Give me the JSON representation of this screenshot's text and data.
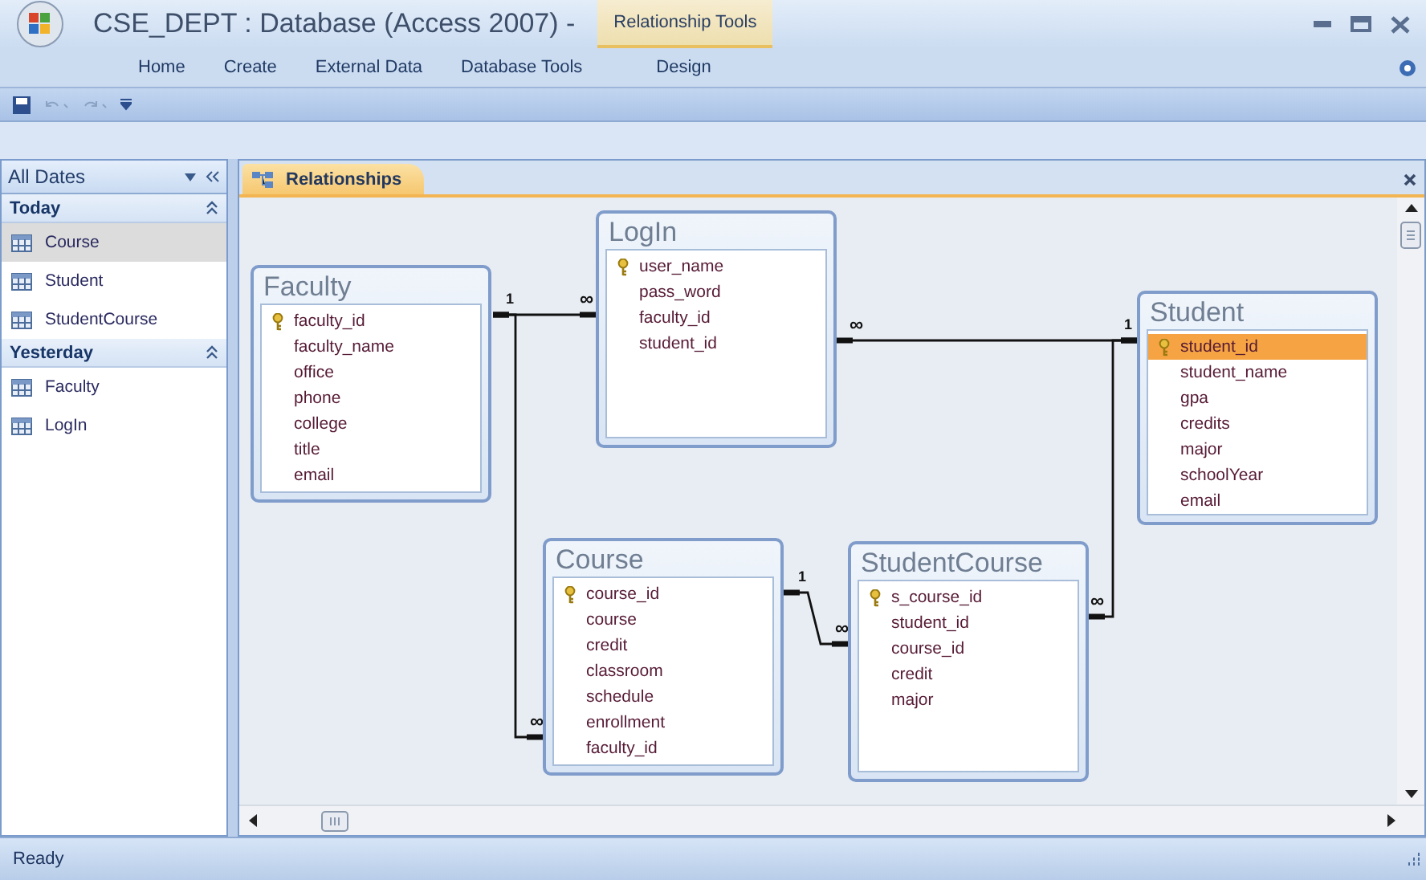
{
  "window": {
    "title": "CSE_DEPT : Database (Access 2007) -",
    "contextual_tab": "Relationship Tools"
  },
  "ribbon_tabs": [
    "Home",
    "Create",
    "External Data",
    "Database Tools",
    "Design"
  ],
  "navigation": {
    "header": "All Dates",
    "groups": [
      {
        "label": "Today",
        "expanded": true,
        "items": [
          {
            "label": "Course",
            "selected": true
          },
          {
            "label": "Student",
            "selected": false
          },
          {
            "label": "StudentCourse",
            "selected": false
          }
        ]
      },
      {
        "label": "Yesterday",
        "expanded": true,
        "items": [
          {
            "label": "Faculty",
            "selected": false
          },
          {
            "label": "LogIn",
            "selected": false
          }
        ]
      }
    ]
  },
  "document_tab": {
    "label": "Relationships"
  },
  "tables": [
    {
      "name": "Faculty",
      "fields": [
        {
          "name": "faculty_id",
          "primary_key": true,
          "selected": false
        },
        {
          "name": "faculty_name",
          "primary_key": false,
          "selected": false
        },
        {
          "name": "office",
          "primary_key": false,
          "selected": false
        },
        {
          "name": "phone",
          "primary_key": false,
          "selected": false
        },
        {
          "name": "college",
          "primary_key": false,
          "selected": false
        },
        {
          "name": "title",
          "primary_key": false,
          "selected": false
        },
        {
          "name": "email",
          "primary_key": false,
          "selected": false
        }
      ]
    },
    {
      "name": "LogIn",
      "fields": [
        {
          "name": "user_name",
          "primary_key": true,
          "selected": false
        },
        {
          "name": "pass_word",
          "primary_key": false,
          "selected": false
        },
        {
          "name": "faculty_id",
          "primary_key": false,
          "selected": false
        },
        {
          "name": "student_id",
          "primary_key": false,
          "selected": false
        }
      ]
    },
    {
      "name": "Student",
      "fields": [
        {
          "name": "student_id",
          "primary_key": true,
          "selected": true
        },
        {
          "name": "student_name",
          "primary_key": false,
          "selected": false
        },
        {
          "name": "gpa",
          "primary_key": false,
          "selected": false
        },
        {
          "name": "credits",
          "primary_key": false,
          "selected": false
        },
        {
          "name": "major",
          "primary_key": false,
          "selected": false
        },
        {
          "name": "schoolYear",
          "primary_key": false,
          "selected": false
        },
        {
          "name": "email",
          "primary_key": false,
          "selected": false
        }
      ]
    },
    {
      "name": "Course",
      "fields": [
        {
          "name": "course_id",
          "primary_key": true,
          "selected": false
        },
        {
          "name": "course",
          "primary_key": false,
          "selected": false
        },
        {
          "name": "credit",
          "primary_key": false,
          "selected": false
        },
        {
          "name": "classroom",
          "primary_key": false,
          "selected": false
        },
        {
          "name": "schedule",
          "primary_key": false,
          "selected": false
        },
        {
          "name": "enrollment",
          "primary_key": false,
          "selected": false
        },
        {
          "name": "faculty_id",
          "primary_key": false,
          "selected": false
        }
      ]
    },
    {
      "name": "StudentCourse",
      "fields": [
        {
          "name": "s_course_id",
          "primary_key": true,
          "selected": false
        },
        {
          "name": "student_id",
          "primary_key": false,
          "selected": false
        },
        {
          "name": "course_id",
          "primary_key": false,
          "selected": false
        },
        {
          "name": "credit",
          "primary_key": false,
          "selected": false
        },
        {
          "name": "major",
          "primary_key": false,
          "selected": false
        }
      ]
    }
  ],
  "relationships": [
    {
      "one_label": "1",
      "many_label": "∞"
    },
    {
      "many_label": "∞"
    },
    {
      "one_label": "1",
      "many_label": "∞"
    },
    {
      "many_label": "∞"
    },
    {
      "one_label": "1",
      "many_label": "∞"
    }
  ],
  "status_bar": "Ready"
}
